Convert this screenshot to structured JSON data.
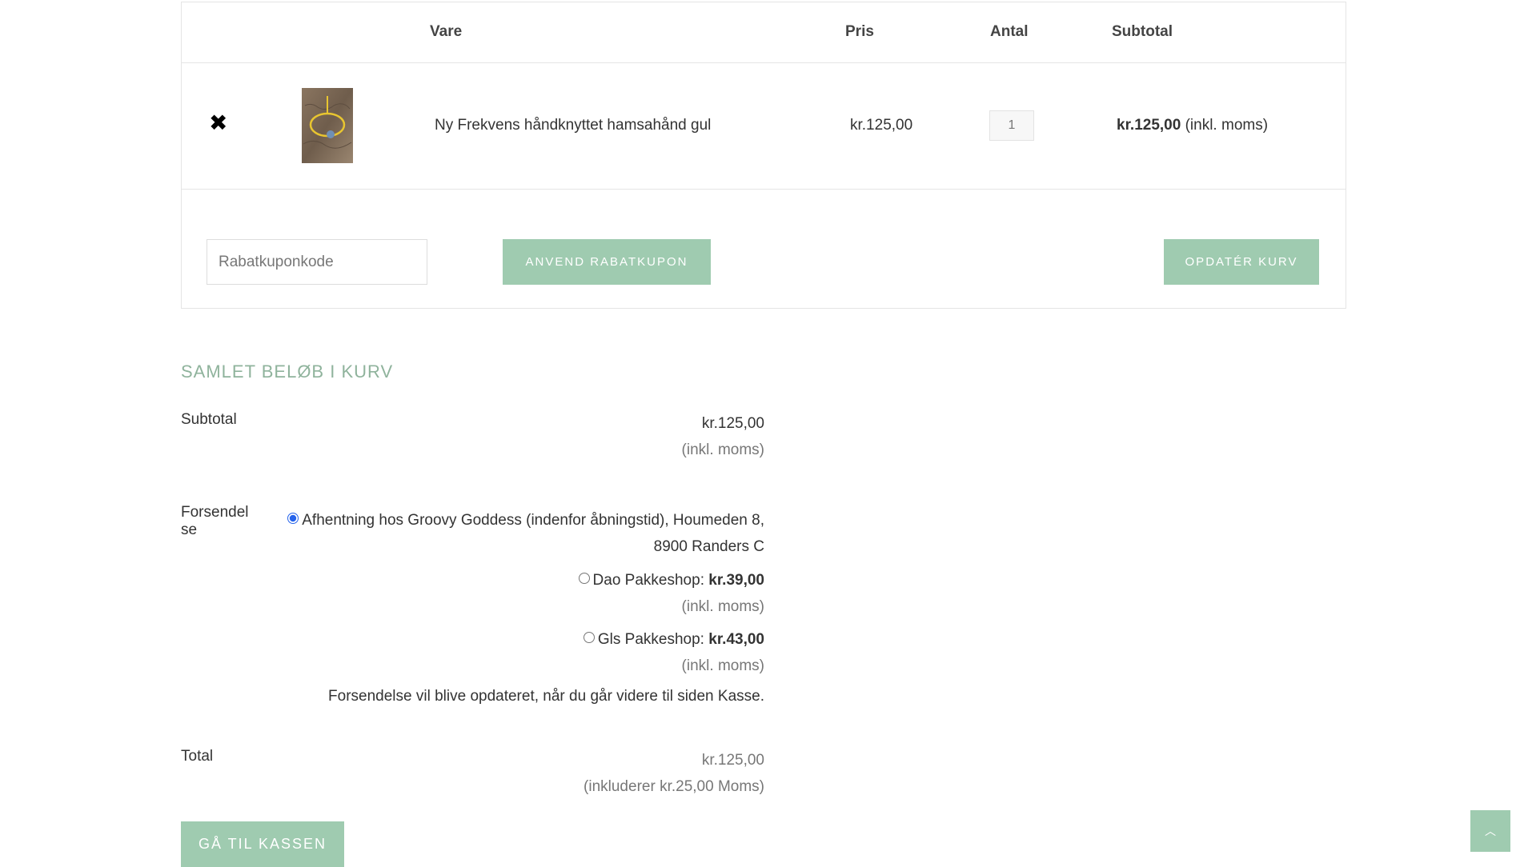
{
  "cart": {
    "headers": {
      "product": "Vare",
      "price": "Pris",
      "quantity": "Antal",
      "subtotal": "Subtotal"
    },
    "item": {
      "name": "Ny Frekvens håndknyttet hamsahånd gul",
      "price": "kr.125,00",
      "quantity": "1",
      "subtotal": "kr.125,00",
      "tax_note": "(inkl. moms)",
      "thumbnail_icon": "bracelet-thumbnail"
    },
    "coupon": {
      "placeholder": "Rabatkuponkode",
      "apply_label": "Anvend rabatkupon"
    },
    "update_label": "Opdatér kurv"
  },
  "totals": {
    "title": "Samlet beløb i kurv",
    "subtotal_label": "Subtotal",
    "subtotal_value": "kr.125,00",
    "subtotal_tax": "(inkl. moms)",
    "shipping_label_1": "Forsendel",
    "shipping_label_2": "se",
    "shipping_options": [
      {
        "label_line1": "Afhentning hos Groovy Goddess (indenfor åbningstid), Houmeden 8,",
        "label_line2": "8900 Randers C",
        "selected": true
      },
      {
        "label": "Dao Pakkeshop:",
        "price": "kr.39,00",
        "tax": "(inkl. moms)",
        "selected": false
      },
      {
        "label": "Gls Pakkeshop:",
        "price": "kr.43,00",
        "tax": "(inkl. moms)",
        "selected": false
      }
    ],
    "shipping_note": "Forsendelse vil blive opdateret, når du går videre til siden Kasse.",
    "total_label": "Total",
    "total_value": "kr.125,00",
    "total_tax": "(inkluderer kr.25,00 Moms)",
    "checkout_label": "Gå til kassen"
  },
  "icons": {
    "remove": "close-icon",
    "scroll_top": "chevron-up-icon"
  },
  "colors": {
    "accent": "#9fcbb0",
    "title": "#8fb39c"
  }
}
